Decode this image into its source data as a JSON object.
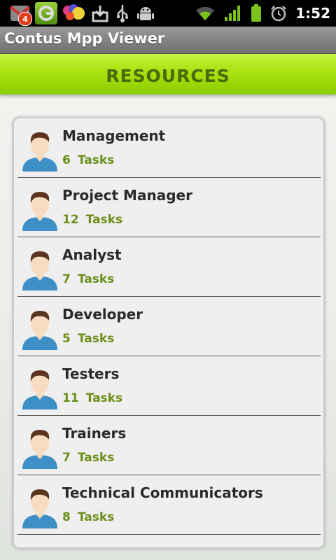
{
  "status_bar": {
    "notification_count": "4",
    "time": "1:52",
    "icons": [
      "gmail-icon",
      "google-search-icon",
      "picasa-icon",
      "download-icon",
      "usb-icon",
      "android-debug-icon",
      "wifi-icon",
      "signal-icon",
      "battery-icon",
      "alarm-icon"
    ]
  },
  "app": {
    "title": "Contus Mpp Viewer"
  },
  "header": {
    "title": "RESOURCES"
  },
  "resources": [
    {
      "name": "Management",
      "count": "6",
      "unit": "Tasks"
    },
    {
      "name": "Project Manager",
      "count": "12",
      "unit": "Tasks"
    },
    {
      "name": "Analyst",
      "count": "7",
      "unit": "Tasks"
    },
    {
      "name": "Developer",
      "count": "5",
      "unit": "Tasks"
    },
    {
      "name": "Testers",
      "count": "11",
      "unit": "Tasks"
    },
    {
      "name": "Trainers",
      "count": "7",
      "unit": "Tasks"
    },
    {
      "name": "Technical Communicators",
      "count": "8",
      "unit": "Tasks"
    }
  ],
  "colors": {
    "accent_green": "#a8e10f",
    "header_text": "#4a6b0d",
    "task_text": "#6c8f1b"
  }
}
